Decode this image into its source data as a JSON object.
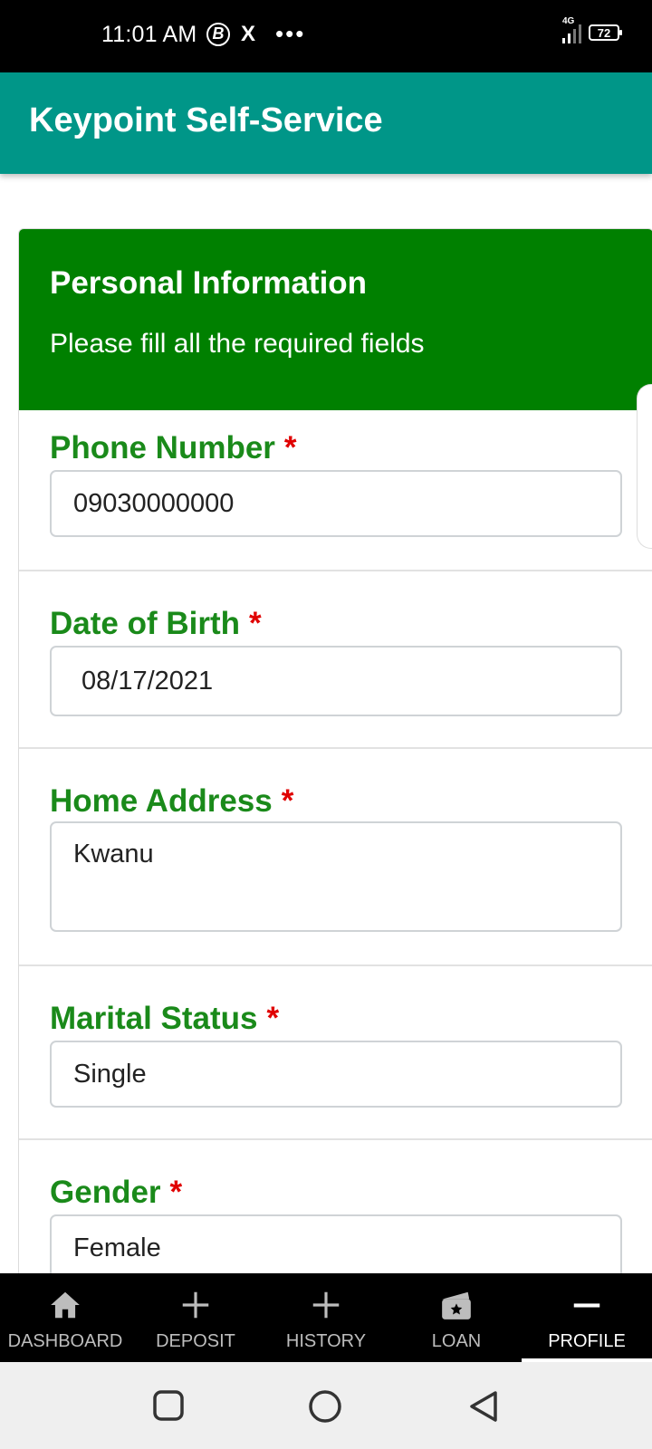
{
  "status_bar": {
    "time": "11:01 AM",
    "b_icon": "B",
    "x_icon": "X",
    "dots": "•••",
    "network": "4G",
    "battery": "72"
  },
  "app": {
    "title": "Keypoint Self-Service"
  },
  "card": {
    "title": "Personal Information",
    "subtitle": "Please fill all the required fields"
  },
  "fields": [
    {
      "label": "Phone Number",
      "value": "09030000000"
    },
    {
      "label": "Date of Birth",
      "value": "08/17/2021"
    },
    {
      "label": "Home Address",
      "value": "Kwanu"
    },
    {
      "label": "Marital Status",
      "value": "Single"
    },
    {
      "label": "Gender",
      "value": "Female"
    }
  ],
  "required_marker": "*",
  "bottom_nav": [
    {
      "label": "DASHBOARD",
      "icon": "home-icon"
    },
    {
      "label": "DEPOSIT",
      "icon": "plus-icon"
    },
    {
      "label": "HISTORY",
      "icon": "plus-icon"
    },
    {
      "label": "LOAN",
      "icon": "wallet-icon"
    },
    {
      "label": "PROFILE",
      "icon": "minus-icon",
      "active": true
    }
  ],
  "colors": {
    "app_bar": "#009688",
    "card_header": "#008000",
    "label": "#1a8a1a",
    "required": "#e00000"
  }
}
